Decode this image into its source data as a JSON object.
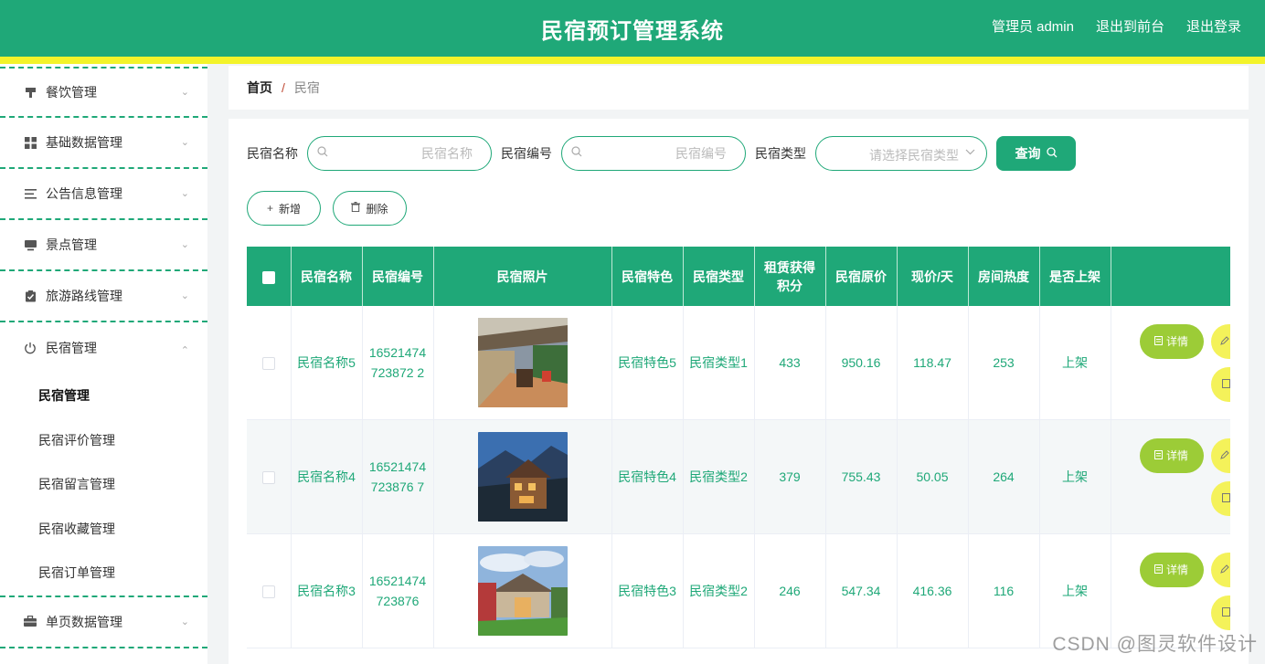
{
  "header": {
    "title": "民宿预订管理系统",
    "admin_label": "管理员 admin",
    "front_label": "退出到前台",
    "logout_label": "退出登录"
  },
  "sidebar": {
    "items": [
      {
        "label": "餐饮管理",
        "icon": "cup-icon"
      },
      {
        "label": "基础数据管理",
        "icon": "grid-icon"
      },
      {
        "label": "公告信息管理",
        "icon": "list-icon"
      },
      {
        "label": "景点管理",
        "icon": "monitor-icon"
      },
      {
        "label": "旅游路线管理",
        "icon": "clipboard-check-icon"
      },
      {
        "label": "民宿管理",
        "icon": "power-icon"
      },
      {
        "label": "单页数据管理",
        "icon": "briefcase-icon"
      }
    ],
    "submenu": [
      {
        "label": "民宿管理"
      },
      {
        "label": "民宿评价管理"
      },
      {
        "label": "民宿留言管理"
      },
      {
        "label": "民宿收藏管理"
      },
      {
        "label": "民宿订单管理"
      }
    ]
  },
  "breadcrumb": {
    "home": "首页",
    "sep": "/",
    "current": "民宿"
  },
  "search": {
    "name_label": "民宿名称",
    "name_placeholder": "民宿名称",
    "code_label": "民宿编号",
    "code_placeholder": "民宿编号",
    "type_label": "民宿类型",
    "type_placeholder": "请选择民宿类型",
    "query_label": "查询"
  },
  "actions": {
    "add_label": "新增",
    "delete_label": "删除"
  },
  "table": {
    "headers": [
      "民宿名称",
      "民宿编号",
      "民宿照片",
      "民宿特色",
      "民宿类型",
      "租赁获得积分",
      "民宿原价",
      "现价/天",
      "房间热度",
      "是否上架"
    ],
    "rows": [
      {
        "name": "民宿名称5",
        "code": "16521474723872 2",
        "feature": "民宿特色5",
        "type": "民宿类型1",
        "points": "433",
        "orig": "950.16",
        "now": "118.47",
        "heat": "253",
        "status": "上架"
      },
      {
        "name": "民宿名称4",
        "code": "16521474723876 7",
        "feature": "民宿特色4",
        "type": "民宿类型2",
        "points": "379",
        "orig": "755.43",
        "now": "50.05",
        "heat": "264",
        "status": "上架"
      },
      {
        "name": "民宿名称3",
        "code": "16521474723876",
        "feature": "民宿特色3",
        "type": "民宿类型2",
        "points": "246",
        "orig": "547.34",
        "now": "416.36",
        "heat": "116",
        "status": "上架"
      }
    ],
    "detail_label": "详情"
  },
  "watermark": "CSDN @图灵软件设计",
  "colors": {
    "primary": "#1fa878",
    "accent_yellow": "#f3f32a",
    "detail_btn": "#9ccc37"
  }
}
